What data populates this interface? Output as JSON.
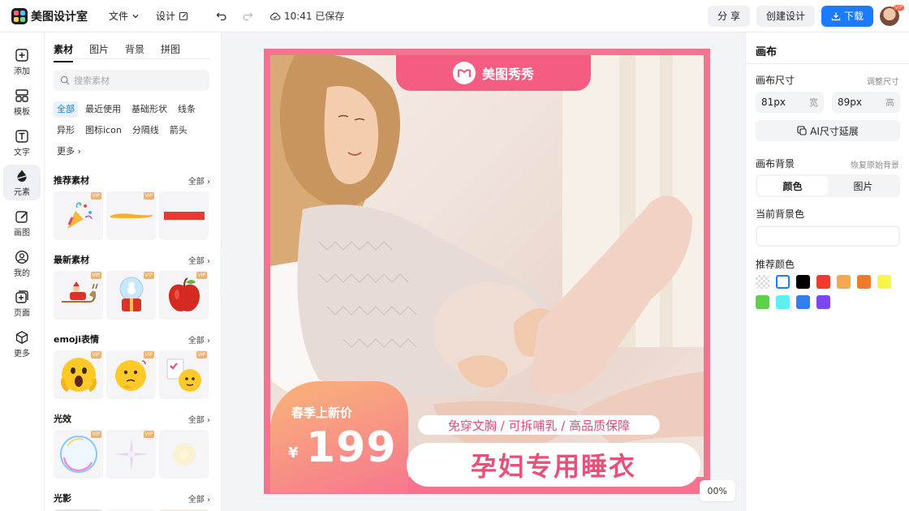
{
  "app": {
    "name": "美图设计室"
  },
  "topbar": {
    "file_menu": "文件",
    "design_menu": "设计",
    "save_status": "10:41 已保存",
    "share_label": "分 享",
    "create_label": "创建设计",
    "download_label": "下载",
    "avatar_badge": "VIP"
  },
  "toolrail": [
    {
      "id": "add",
      "label": "添加",
      "icon": "plus-square-icon"
    },
    {
      "id": "template",
      "label": "模板",
      "icon": "layout-icon"
    },
    {
      "id": "text",
      "label": "文字",
      "icon": "text-icon"
    },
    {
      "id": "element",
      "label": "元素",
      "icon": "shapes-icon",
      "active": true
    },
    {
      "id": "draw",
      "label": "画图",
      "icon": "pen-icon"
    },
    {
      "id": "mine",
      "label": "我的",
      "icon": "user-icon"
    },
    {
      "id": "pages",
      "label": "页面",
      "icon": "add-page-icon"
    },
    {
      "id": "more",
      "label": "更多",
      "icon": "cube-icon"
    }
  ],
  "panel": {
    "tabs": [
      "素材",
      "图片",
      "背景",
      "拼图"
    ],
    "active_tab": "素材",
    "search_placeholder": "搜索素材",
    "chips": [
      "全部",
      "最近使用",
      "基础形状",
      "线条",
      "异形",
      "图标icon",
      "分隔线",
      "箭头",
      "更多"
    ],
    "active_chip": "全部",
    "sections": [
      {
        "title": "推荐素材",
        "all": "全部",
        "cards": [
          {
            "vip": "VIP",
            "icon": "party-popper-icon"
          },
          {
            "vip": "VIP",
            "icon": "brush-stroke-icon"
          },
          {
            "vip": "",
            "icon": "red-bar-icon"
          }
        ]
      },
      {
        "title": "最新素材",
        "all": "全部",
        "cards": [
          {
            "vip": "VIP",
            "icon": "sleigh-icon"
          },
          {
            "vip": "VIP",
            "icon": "snow-globe-icon"
          },
          {
            "vip": "VIP",
            "icon": "apple-icon"
          }
        ]
      },
      {
        "title": "emoji表情",
        "all": "全部",
        "cards": [
          {
            "vip": "VIP",
            "icon": "screaming-face-icon"
          },
          {
            "vip": "VIP",
            "icon": "thinking-face-icon"
          },
          {
            "vip": "VIP",
            "icon": "checklist-face-icon"
          }
        ]
      },
      {
        "title": "光效",
        "all": "全部",
        "cards": [
          {
            "vip": "VIP",
            "icon": "bubble-icon"
          },
          {
            "vip": "VIP",
            "icon": "sparkle-icon"
          },
          {
            "vip": "",
            "icon": "glow-icon"
          }
        ]
      },
      {
        "title": "光影",
        "all": "全部",
        "cards": []
      }
    ]
  },
  "poster": {
    "brand": "美图秀秀",
    "price_sub": "春季上新价",
    "yen": "¥",
    "price": "199",
    "features": "免穿文胸 / 可拆哺乳 / 高品质保障",
    "title": "孕妇专用睡衣",
    "colors": {
      "frame": "#f4738f",
      "accent": "#f45c81"
    }
  },
  "zoom": {
    "value": "00%"
  },
  "props": {
    "title": "画布",
    "size_label": "画布尺寸",
    "size_action": "调整尺寸",
    "width": {
      "value": "81px",
      "unit": "宽"
    },
    "height": {
      "value": "89px",
      "unit": "高"
    },
    "ai_extend": "AI尺寸延展",
    "bg_label": "画布背景",
    "bg_reset": "恢复原始背景",
    "bg_tabs": [
      "颜色",
      "图片"
    ],
    "bg_active": "颜色",
    "current_color_label": "当前背景色",
    "recommend_label": "推荐颜色",
    "swatches": [
      "transparent",
      "#ffffff",
      "#000000",
      "#f03b2c",
      "#f5a84f",
      "#f07a2a",
      "#f7f545",
      "#5ed04a",
      "#5ef0f0",
      "#2f7fee",
      "#7d47ee"
    ]
  }
}
